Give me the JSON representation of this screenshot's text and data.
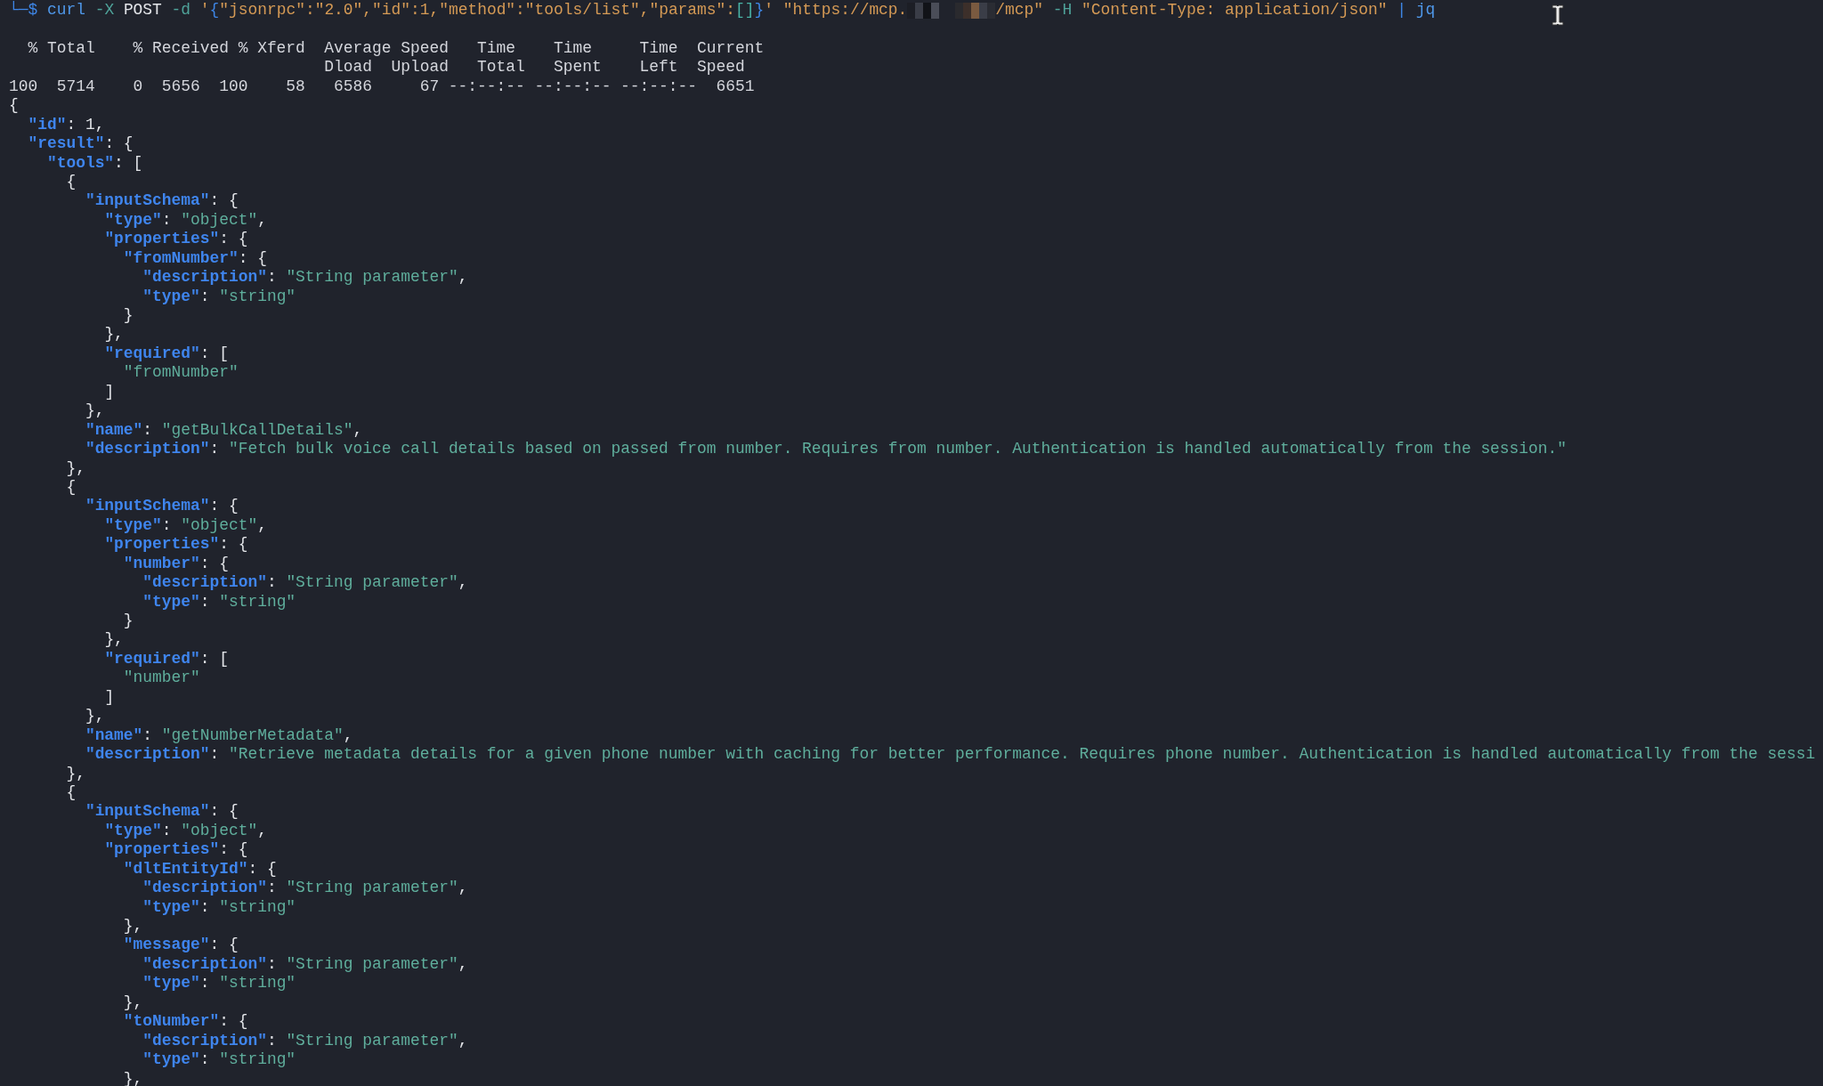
{
  "command": {
    "prompt": "└─$",
    "segments": [
      {
        "kind": "cmd",
        "text": "curl "
      },
      {
        "kind": "flag",
        "text": "-X "
      },
      {
        "kind": "plain",
        "text": "POST "
      },
      {
        "kind": "flag",
        "text": "-d "
      },
      {
        "kind": "str",
        "text": "'"
      },
      {
        "kind": "brace",
        "text": "{"
      },
      {
        "kind": "str",
        "text": "\"jsonrpc\":\"2.0\",\"id\":1,\"method\":\"tools/list\",\"params\":"
      },
      {
        "kind": "bracket",
        "text": "[]"
      },
      {
        "kind": "brace",
        "text": "}"
      },
      {
        "kind": "str",
        "text": "' \"https://mcp."
      },
      {
        "kind": "redacted"
      },
      {
        "kind": "str",
        "text": "/mcp\" "
      },
      {
        "kind": "flag",
        "text": "-H "
      },
      {
        "kind": "str",
        "text": "\"Content-Type: application/json\" "
      },
      {
        "kind": "pipe",
        "text": "| "
      },
      {
        "kind": "cmd",
        "text": "jq"
      }
    ]
  },
  "progress": [
    "  % Total    % Received % Xferd  Average Speed   Time    Time     Time  Current",
    "                                 Dload  Upload   Total   Spent    Left  Speed",
    "100  5714    0  5656  100    58   6586     67 --:--:-- --:--:-- --:--:--  6651"
  ],
  "output": [
    [
      {
        "kind": "punct",
        "text": "{"
      }
    ],
    [
      {
        "kind": "key",
        "text": "  \"id\""
      },
      {
        "kind": "punct",
        "text": ": 1,"
      }
    ],
    [
      {
        "kind": "key",
        "text": "  \"result\""
      },
      {
        "kind": "punct",
        "text": ": {"
      }
    ],
    [
      {
        "kind": "key",
        "text": "    \"tools\""
      },
      {
        "kind": "punct",
        "text": ": ["
      }
    ],
    [
      {
        "kind": "punct",
        "text": "      {"
      }
    ],
    [
      {
        "kind": "key",
        "text": "        \"inputSchema\""
      },
      {
        "kind": "punct",
        "text": ": {"
      }
    ],
    [
      {
        "kind": "key",
        "text": "          \"type\""
      },
      {
        "kind": "punct",
        "text": ": "
      },
      {
        "kind": "value",
        "text": "\"object\""
      },
      {
        "kind": "punct",
        "text": ","
      }
    ],
    [
      {
        "kind": "key",
        "text": "          \"properties\""
      },
      {
        "kind": "punct",
        "text": ": {"
      }
    ],
    [
      {
        "kind": "key",
        "text": "            \"fromNumber\""
      },
      {
        "kind": "punct",
        "text": ": {"
      }
    ],
    [
      {
        "kind": "key",
        "text": "              \"description\""
      },
      {
        "kind": "punct",
        "text": ": "
      },
      {
        "kind": "value",
        "text": "\"String parameter\""
      },
      {
        "kind": "punct",
        "text": ","
      }
    ],
    [
      {
        "kind": "key",
        "text": "              \"type\""
      },
      {
        "kind": "punct",
        "text": ": "
      },
      {
        "kind": "value",
        "text": "\"string\""
      }
    ],
    [
      {
        "kind": "punct",
        "text": "            }"
      }
    ],
    [
      {
        "kind": "punct",
        "text": "          },"
      }
    ],
    [
      {
        "kind": "key",
        "text": "          \"required\""
      },
      {
        "kind": "punct",
        "text": ": ["
      }
    ],
    [
      {
        "kind": "value",
        "text": "            \"fromNumber\""
      }
    ],
    [
      {
        "kind": "punct",
        "text": "          ]"
      }
    ],
    [
      {
        "kind": "punct",
        "text": "        },"
      }
    ],
    [
      {
        "kind": "key",
        "text": "        \"name\""
      },
      {
        "kind": "punct",
        "text": ": "
      },
      {
        "kind": "value",
        "text": "\"getBulkCallDetails\""
      },
      {
        "kind": "punct",
        "text": ","
      }
    ],
    [
      {
        "kind": "key",
        "text": "        \"description\""
      },
      {
        "kind": "punct",
        "text": ": "
      },
      {
        "kind": "value",
        "text": "\"Fetch bulk voice call details based on passed from number. Requires from number. Authentication is handled automatically from the session.\""
      }
    ],
    [
      {
        "kind": "punct",
        "text": "      },"
      }
    ],
    [
      {
        "kind": "punct",
        "text": "      {"
      }
    ],
    [
      {
        "kind": "key",
        "text": "        \"inputSchema\""
      },
      {
        "kind": "punct",
        "text": ": {"
      }
    ],
    [
      {
        "kind": "key",
        "text": "          \"type\""
      },
      {
        "kind": "punct",
        "text": ": "
      },
      {
        "kind": "value",
        "text": "\"object\""
      },
      {
        "kind": "punct",
        "text": ","
      }
    ],
    [
      {
        "kind": "key",
        "text": "          \"properties\""
      },
      {
        "kind": "punct",
        "text": ": {"
      }
    ],
    [
      {
        "kind": "key",
        "text": "            \"number\""
      },
      {
        "kind": "punct",
        "text": ": {"
      }
    ],
    [
      {
        "kind": "key",
        "text": "              \"description\""
      },
      {
        "kind": "punct",
        "text": ": "
      },
      {
        "kind": "value",
        "text": "\"String parameter\""
      },
      {
        "kind": "punct",
        "text": ","
      }
    ],
    [
      {
        "kind": "key",
        "text": "              \"type\""
      },
      {
        "kind": "punct",
        "text": ": "
      },
      {
        "kind": "value",
        "text": "\"string\""
      }
    ],
    [
      {
        "kind": "punct",
        "text": "            }"
      }
    ],
    [
      {
        "kind": "punct",
        "text": "          },"
      }
    ],
    [
      {
        "kind": "key",
        "text": "          \"required\""
      },
      {
        "kind": "punct",
        "text": ": ["
      }
    ],
    [
      {
        "kind": "value",
        "text": "            \"number\""
      }
    ],
    [
      {
        "kind": "punct",
        "text": "          ]"
      }
    ],
    [
      {
        "kind": "punct",
        "text": "        },"
      }
    ],
    [
      {
        "kind": "key",
        "text": "        \"name\""
      },
      {
        "kind": "punct",
        "text": ": "
      },
      {
        "kind": "value",
        "text": "\"getNumberMetadata\""
      },
      {
        "kind": "punct",
        "text": ","
      }
    ],
    [
      {
        "kind": "key",
        "text": "        \"description\""
      },
      {
        "kind": "punct",
        "text": ": "
      },
      {
        "kind": "value",
        "text": "\"Retrieve metadata details for a given phone number with caching for better performance. Requires phone number. Authentication is handled automatically from the sessi"
      }
    ],
    [
      {
        "kind": "punct",
        "text": "      },"
      }
    ],
    [
      {
        "kind": "punct",
        "text": "      {"
      }
    ],
    [
      {
        "kind": "key",
        "text": "        \"inputSchema\""
      },
      {
        "kind": "punct",
        "text": ": {"
      }
    ],
    [
      {
        "kind": "key",
        "text": "          \"type\""
      },
      {
        "kind": "punct",
        "text": ": "
      },
      {
        "kind": "value",
        "text": "\"object\""
      },
      {
        "kind": "punct",
        "text": ","
      }
    ],
    [
      {
        "kind": "key",
        "text": "          \"properties\""
      },
      {
        "kind": "punct",
        "text": ": {"
      }
    ],
    [
      {
        "kind": "key",
        "text": "            \"dltEntityId\""
      },
      {
        "kind": "punct",
        "text": ": {"
      }
    ],
    [
      {
        "kind": "key",
        "text": "              \"description\""
      },
      {
        "kind": "punct",
        "text": ": "
      },
      {
        "kind": "value",
        "text": "\"String parameter\""
      },
      {
        "kind": "punct",
        "text": ","
      }
    ],
    [
      {
        "kind": "key",
        "text": "              \"type\""
      },
      {
        "kind": "punct",
        "text": ": "
      },
      {
        "kind": "value",
        "text": "\"string\""
      }
    ],
    [
      {
        "kind": "punct",
        "text": "            },"
      }
    ],
    [
      {
        "kind": "key",
        "text": "            \"message\""
      },
      {
        "kind": "punct",
        "text": ": {"
      }
    ],
    [
      {
        "kind": "key",
        "text": "              \"description\""
      },
      {
        "kind": "punct",
        "text": ": "
      },
      {
        "kind": "value",
        "text": "\"String parameter\""
      },
      {
        "kind": "punct",
        "text": ","
      }
    ],
    [
      {
        "kind": "key",
        "text": "              \"type\""
      },
      {
        "kind": "punct",
        "text": ": "
      },
      {
        "kind": "value",
        "text": "\"string\""
      }
    ],
    [
      {
        "kind": "punct",
        "text": "            },"
      }
    ],
    [
      {
        "kind": "key",
        "text": "            \"toNumber\""
      },
      {
        "kind": "punct",
        "text": ": {"
      }
    ],
    [
      {
        "kind": "key",
        "text": "              \"description\""
      },
      {
        "kind": "punct",
        "text": ": "
      },
      {
        "kind": "value",
        "text": "\"String parameter\""
      },
      {
        "kind": "punct",
        "text": ","
      }
    ],
    [
      {
        "kind": "key",
        "text": "              \"type\""
      },
      {
        "kind": "punct",
        "text": ": "
      },
      {
        "kind": "value",
        "text": "\"string\""
      }
    ],
    [
      {
        "kind": "punct",
        "text": "            },"
      }
    ]
  ]
}
